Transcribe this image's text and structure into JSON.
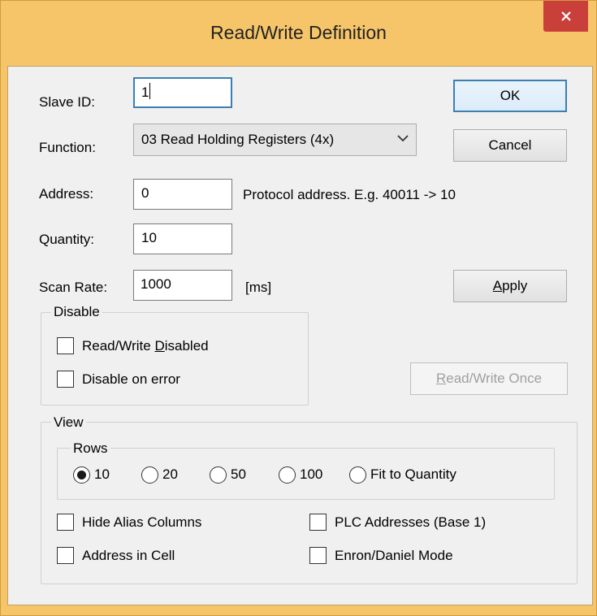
{
  "window": {
    "title": "Read/Write Definition"
  },
  "form": {
    "slave_id": {
      "label": "Slave ID:",
      "value": "1"
    },
    "function": {
      "label": "Function:",
      "value": "03 Read Holding Registers (4x)"
    },
    "address": {
      "label": "Address:",
      "value": "0",
      "hint": "Protocol address. E.g. 40011 -> 10"
    },
    "quantity": {
      "label": "Quantity:",
      "value": "10"
    },
    "scan_rate": {
      "label": "Scan Rate:",
      "value": "1000",
      "unit": "[ms]"
    }
  },
  "buttons": {
    "ok": "OK",
    "cancel": "Cancel",
    "apply": {
      "mnemonic": "A",
      "rest": "pply"
    },
    "read_write_once": {
      "mnemonic": "R",
      "rest": "ead/Write Once",
      "enabled": false
    }
  },
  "disable_group": {
    "title": "Disable",
    "rw_disabled": {
      "before": "Read/Write ",
      "mnemonic": "D",
      "after": "isabled",
      "checked": false
    },
    "disable_on_error": {
      "label": "Disable on error",
      "checked": false
    }
  },
  "view_group": {
    "title": "View",
    "rows": {
      "title": "Rows",
      "options": [
        "10",
        "20",
        "50",
        "100",
        "Fit to Quantity"
      ],
      "selected": "10"
    },
    "checkboxes": {
      "hide_alias": {
        "label": "Hide Alias Columns",
        "checked": false
      },
      "address_in_cell": {
        "label": "Address in Cell",
        "checked": false
      },
      "plc_addresses": {
        "label": "PLC Addresses (Base 1)",
        "checked": false
      },
      "enron_daniel": {
        "label": "Enron/Daniel Mode",
        "checked": false
      }
    }
  },
  "colors": {
    "frame": "#f6c56a",
    "close": "#c9403a",
    "accent": "#3c7fb1",
    "client_bg": "#f0f0f0"
  }
}
